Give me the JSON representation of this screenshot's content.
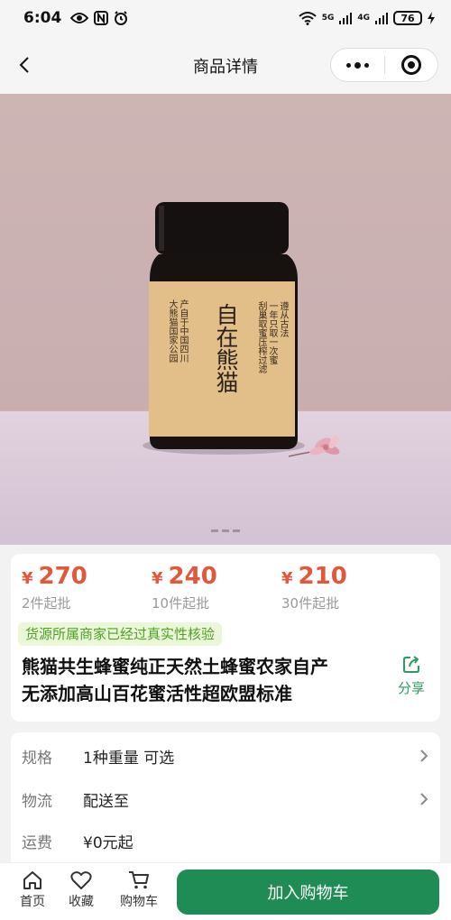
{
  "status_bar": {
    "time": "6:04",
    "network_1": "5G",
    "network_2": "4G",
    "battery": "76",
    "icons": [
      "eye-icon",
      "nfc-icon",
      "alarm-icon",
      "wifi-icon",
      "signal-icon",
      "charging-icon"
    ]
  },
  "nav": {
    "title": "商品详情",
    "back_icon": "chevron-left-icon",
    "more_icon": "more-dots-icon",
    "close_icon": "target-icon"
  },
  "hero": {
    "image_slide_count": 3,
    "active_slide": 1,
    "jar_label": {
      "main_text": "自在熊猫",
      "right_col": [
        "遵从古法",
        "一年只取一次蜜",
        "刮巢取蜜压榨过滤"
      ],
      "left_col": [
        "产自于中国四川",
        "大熊猫国家公园"
      ]
    },
    "colors": {
      "backdrop": "#cdb5b4",
      "table": "#dccbd9",
      "label": "#e2bf88",
      "jar": "#17120f"
    }
  },
  "pricing": {
    "currency": "¥",
    "tiers": [
      {
        "price": "270",
        "note": "2件起批"
      },
      {
        "price": "240",
        "note": "10件起批"
      },
      {
        "price": "210",
        "note": "30件起批"
      }
    ],
    "verify_badge": "货源所属商家已经过真实性核验",
    "product_title_line1": "熊猫共生蜂蜜纯正天然土蜂蜜农家自产",
    "product_title_line2": "无添加高山百花蜜活性超欧盟标准",
    "share_label": "分享",
    "accent_color": "#e3573b"
  },
  "specs": {
    "rows": [
      {
        "label": "规格",
        "value": "1种重量 可选"
      },
      {
        "label": "物流",
        "value": "配送至"
      },
      {
        "label": "运费",
        "value": "¥0元起"
      }
    ]
  },
  "bottom_bar": {
    "tabs": [
      {
        "label": "首页",
        "icon": "home-icon"
      },
      {
        "label": "收藏",
        "icon": "heart-icon"
      },
      {
        "label": "购物车",
        "icon": "cart-icon"
      }
    ],
    "add_to_cart": "加入购物车",
    "brand_color": "#1f8c55"
  }
}
